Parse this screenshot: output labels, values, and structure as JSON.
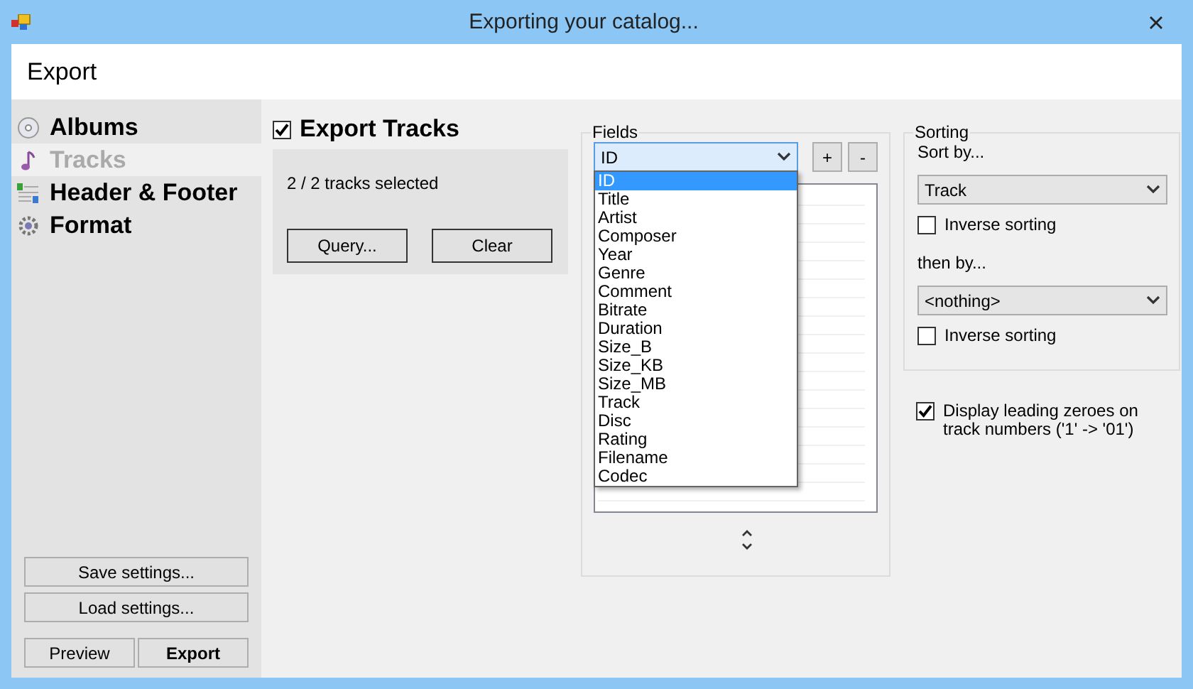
{
  "window": {
    "title": "Exporting your catalog..."
  },
  "header": {
    "title": "Export"
  },
  "sidebar": {
    "items": [
      {
        "label": "Albums",
        "kind": "disc",
        "selected": false
      },
      {
        "label": "Tracks",
        "kind": "note",
        "selected": true
      },
      {
        "label": "Header & Footer",
        "kind": "headfoot",
        "selected": false
      },
      {
        "label": "Format",
        "kind": "gear",
        "selected": false
      }
    ],
    "settings_buttons": [
      {
        "label": "Save settings..."
      },
      {
        "label": "Load settings..."
      }
    ],
    "action_buttons": [
      {
        "label": "Preview",
        "kind": "normal"
      },
      {
        "label": "Export",
        "kind": "default"
      }
    ]
  },
  "export_tracks": {
    "label": "Export Tracks",
    "checked": true
  },
  "query": {
    "status": "2 / 2 tracks selected",
    "buttons": [
      {
        "label": "Query..."
      },
      {
        "label": "Clear"
      }
    ]
  },
  "fields": {
    "title": "Fields",
    "combo": {
      "value": "ID",
      "expanded": true
    },
    "add": "+",
    "remove": "-",
    "options": [
      {
        "label": "ID",
        "selected": true
      },
      {
        "label": "Title",
        "selected": false
      },
      {
        "label": "Artist",
        "selected": false
      },
      {
        "label": "Composer",
        "selected": false
      },
      {
        "label": "Year",
        "selected": false
      },
      {
        "label": "Genre",
        "selected": false
      },
      {
        "label": "Comment",
        "selected": false
      },
      {
        "label": "Bitrate",
        "selected": false
      },
      {
        "label": "Duration",
        "selected": false
      },
      {
        "label": "Size_B",
        "selected": false
      },
      {
        "label": "Size_KB",
        "selected": false
      },
      {
        "label": "Size_MB",
        "selected": false
      },
      {
        "label": "Track",
        "selected": false
      },
      {
        "label": "Disc",
        "selected": false
      },
      {
        "label": "Rating",
        "selected": false
      },
      {
        "label": "Filename",
        "selected": false
      },
      {
        "label": "Codec",
        "selected": false
      }
    ]
  },
  "sorting": {
    "title": "Sorting",
    "sort_by": "Sort by...",
    "first": {
      "value": "Track"
    },
    "first_inverse": {
      "label": "Inverse sorting",
      "checked": false
    },
    "then_by": "then by...",
    "second": {
      "value": "<nothing>"
    },
    "second_inverse": {
      "label": "Inverse sorting",
      "checked": false
    }
  },
  "leading_zeroes": {
    "label": "Display leading zeroes on track numbers ('1' -> '01')",
    "checked": true
  }
}
